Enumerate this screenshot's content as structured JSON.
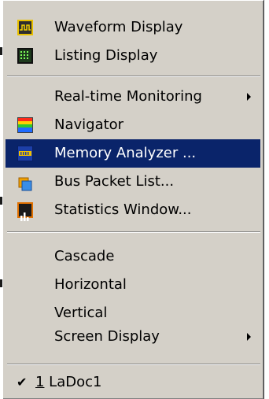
{
  "menu": {
    "items": [
      {
        "label": "Waveform Display",
        "icon": "waveform-icon"
      },
      {
        "label": "Listing Display",
        "icon": "listing-icon"
      },
      {
        "label": "Real-time Monitoring",
        "submenu": true
      },
      {
        "label": "Navigator",
        "icon": "navigator-icon"
      },
      {
        "label": "Memory Analyzer ...",
        "icon": "memory-analyzer-icon",
        "highlighted": true
      },
      {
        "label": "Bus Packet List...",
        "icon": "bus-packet-icon"
      },
      {
        "label": "Statistics Window...",
        "icon": "statistics-icon"
      },
      {
        "label": "Cascade"
      },
      {
        "label": "Horizontal"
      },
      {
        "label": "Vertical"
      },
      {
        "label": "Screen Display",
        "submenu": true
      }
    ],
    "document": {
      "checkmark": "✔",
      "accel": "1",
      "label": " LaDoc1"
    }
  },
  "colors": {
    "menu_bg": "#d4d0c8",
    "highlight_bg": "#0a246a",
    "highlight_text": "#ffffff"
  }
}
